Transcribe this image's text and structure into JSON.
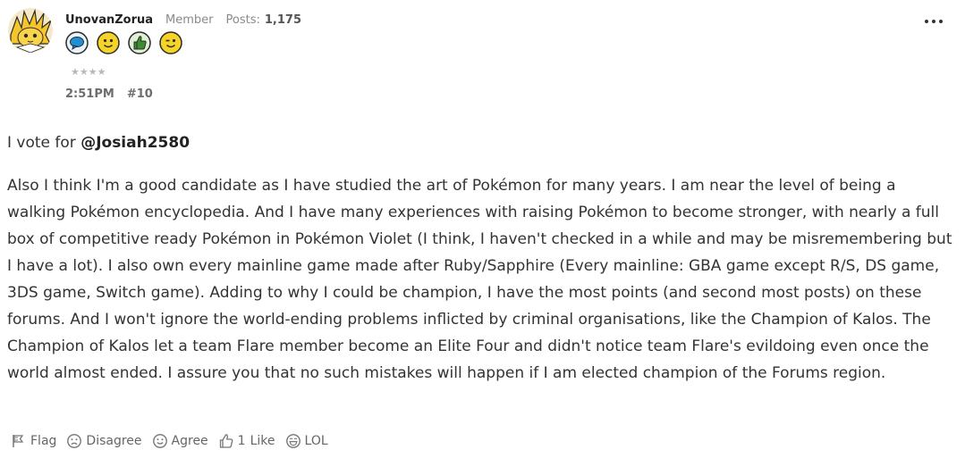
{
  "author": {
    "username": "UnovanZorua",
    "role": "Member",
    "posts_label": "Posts:",
    "posts_count": "1,175",
    "stars": "★★★★",
    "avatar_icon": "jolteon-avatar",
    "badges": [
      "speech-bubble-badge",
      "smiley-badge",
      "thumbs-up-badge",
      "wink-badge"
    ]
  },
  "meta": {
    "time": "2:51PM",
    "post_number": "#10"
  },
  "post": {
    "intro_text": "I vote for ",
    "mention": "@Josiah2580",
    "body": "Also I think I'm a good candidate as I have studied the art of Pokémon for many years. I am near the level of being a walking Pokémon encyclopedia. And I have many experiences with raising Pokémon to become stronger, with nearly a full box of competitive ready Pokémon in Pokémon Violet (I think, I haven't checked in a while and may be misremembering but I have a lot). I also own every mainline game made after Ruby/Sapphire (Every mainline: GBA game except R/S, DS game, 3DS game, Switch game). Adding to why I could be champion, I have the most points (and second most posts) on these forums. And I won't ignore the world-ending problems inflicted by criminal organisations, like the Champion of Kalos. The Champion of Kalos let a team Flare member become an Elite Four and didn't notice team Flare's evildoing even once the world almost ended. I assure you that no such mistakes will happen if I am elected champion of the Forums region."
  },
  "reactions": {
    "flag": "Flag",
    "disagree": "Disagree",
    "agree": "Agree",
    "like_count": "1",
    "like": "Like",
    "lol": "LOL"
  },
  "colors": {
    "badge_fill": "#f5d327",
    "badge_stroke": "#333333",
    "speech_fill": "#1f8fd6",
    "thumb_fill": "#3c8f2f",
    "muted_text": "#8a8a8a"
  }
}
